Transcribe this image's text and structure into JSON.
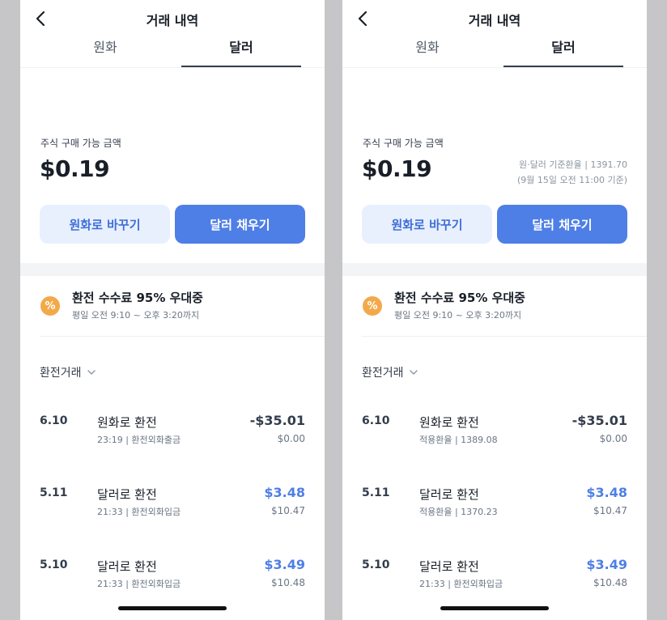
{
  "screens": [
    {
      "header": {
        "title": "거래 내역"
      },
      "tabs": [
        {
          "label": "원화"
        },
        {
          "label": "달러"
        }
      ],
      "balance": {
        "label": "주식 구매 가능 금액",
        "amount": "$0.19"
      },
      "rate": null,
      "buttons": {
        "to_krw": "원화로 바꾸기",
        "fill_usd": "달러 채우기"
      },
      "promo": {
        "icon": "%",
        "title": "환전 수수료 95% 우대중",
        "subtitle": "평일 오전 9:10 ~ 오후 3:20까지"
      },
      "filter": {
        "label": "환전거래"
      },
      "transactions": [
        {
          "date": "6.10",
          "title": "원화로 환전",
          "sub": "23:19 | 환전외화출금",
          "amount": "-$35.01",
          "krw": "$0.00",
          "direction": "out"
        },
        {
          "date": "5.11",
          "title": "달러로 환전",
          "sub": "21:33 | 환전외화입금",
          "amount": "$3.48",
          "krw": "$10.47",
          "direction": "in"
        },
        {
          "date": "5.10",
          "title": "달러로 환전",
          "sub": "21:33 | 환전외화입금",
          "amount": "$3.49",
          "krw": "$10.48",
          "direction": "in"
        }
      ]
    },
    {
      "header": {
        "title": "거래 내역"
      },
      "tabs": [
        {
          "label": "원화"
        },
        {
          "label": "달러"
        }
      ],
      "balance": {
        "label": "주식 구매 가능 금액",
        "amount": "$0.19"
      },
      "rate": {
        "line1": "원·달러 기준환율 | 1391.70",
        "line2": "(9월 15일 오전 11:00 기준)"
      },
      "buttons": {
        "to_krw": "원화로 바꾸기",
        "fill_usd": "달러 채우기"
      },
      "promo": {
        "icon": "%",
        "title": "환전 수수료 95% 우대중",
        "subtitle": "평일 오전 9:10 ~ 오후 3:20까지"
      },
      "filter": {
        "label": "환전거래"
      },
      "transactions": [
        {
          "date": "6.10",
          "title": "원화로 환전",
          "sub": "적용환율 | 1389.08",
          "amount": "-$35.01",
          "krw": "$0.00",
          "direction": "out"
        },
        {
          "date": "5.11",
          "title": "달러로 환전",
          "sub": "적용환율 | 1370.23",
          "amount": "$3.48",
          "krw": "$10.47",
          "direction": "in"
        },
        {
          "date": "5.10",
          "title": "달러로 환전",
          "sub": "21:33 | 환전외화입금",
          "amount": "$3.49",
          "krw": "$10.48",
          "direction": "in"
        }
      ]
    }
  ],
  "colors": {
    "accent": "#4e7fe6",
    "accent_light": "#e8f0fd",
    "promo": "#f3a94a",
    "background": "#c6c6c8"
  }
}
